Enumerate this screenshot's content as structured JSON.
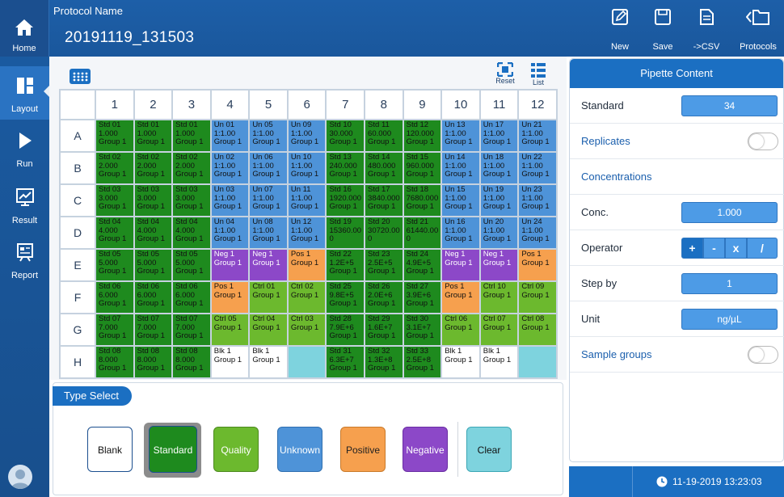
{
  "header": {
    "home_label": "Home",
    "protocol_caption": "Protocol Name",
    "protocol_value": "20191119_131503",
    "buttons": [
      {
        "label": "New",
        "icon": "edit-icon"
      },
      {
        "label": "Save",
        "icon": "save-icon"
      },
      {
        "label": "->CSV",
        "icon": "export-csv-icon"
      },
      {
        "label": "Protocols",
        "icon": "folder-icon"
      }
    ]
  },
  "sidebar": {
    "items": [
      {
        "label": "Layout",
        "icon": "layout-icon",
        "active": true
      },
      {
        "label": "Run",
        "icon": "play-icon",
        "active": false
      },
      {
        "label": "Result",
        "icon": "chart-icon",
        "active": false
      },
      {
        "label": "Report",
        "icon": "report-icon",
        "active": false
      }
    ]
  },
  "plate": {
    "tools": {
      "reset": "Reset",
      "list": "List"
    },
    "columns": [
      "1",
      "2",
      "3",
      "4",
      "5",
      "6",
      "7",
      "8",
      "9",
      "10",
      "11",
      "12"
    ],
    "rows": [
      {
        "label": "A",
        "cells": [
          {
            "type": "std",
            "l1": "Std 01",
            "l2": "1.000",
            "l3": "Group 1"
          },
          {
            "type": "std",
            "l1": "Std 01",
            "l2": "1.000",
            "l3": "Group 1"
          },
          {
            "type": "std",
            "l1": "Std 01",
            "l2": "1.000",
            "l3": "Group 1"
          },
          {
            "type": "unk",
            "l1": "Un 01",
            "l2": "1:1.00",
            "l3": "Group 1"
          },
          {
            "type": "unk",
            "l1": "Un 05",
            "l2": "1:1.00",
            "l3": "Group 1"
          },
          {
            "type": "unk",
            "l1": "Un 09",
            "l2": "1:1.00",
            "l3": "Group 1"
          },
          {
            "type": "std",
            "l1": "Std 10",
            "l2": "30.000",
            "l3": "Group 1"
          },
          {
            "type": "std",
            "l1": "Std 11",
            "l2": "60.000",
            "l3": "Group 1"
          },
          {
            "type": "std",
            "l1": "Std 12",
            "l2": "120.000",
            "l3": "Group 1"
          },
          {
            "type": "unk",
            "l1": "Un 13",
            "l2": "1:1.00",
            "l3": "Group 1"
          },
          {
            "type": "unk",
            "l1": "Un 17",
            "l2": "1:1.00",
            "l3": "Group 1"
          },
          {
            "type": "unk",
            "l1": "Un 21",
            "l2": "1:1.00",
            "l3": "Group 1"
          }
        ]
      },
      {
        "label": "B",
        "cells": [
          {
            "type": "std",
            "l1": "Std 02",
            "l2": "2.000",
            "l3": "Group 1"
          },
          {
            "type": "std",
            "l1": "Std 02",
            "l2": "2.000",
            "l3": "Group 1"
          },
          {
            "type": "std",
            "l1": "Std 02",
            "l2": "2.000",
            "l3": "Group 1"
          },
          {
            "type": "unk",
            "l1": "Un 02",
            "l2": "1:1.00",
            "l3": "Group 1"
          },
          {
            "type": "unk",
            "l1": "Un 06",
            "l2": "1:1.00",
            "l3": "Group 1"
          },
          {
            "type": "unk",
            "l1": "Un 10",
            "l2": "1:1.00",
            "l3": "Group 1"
          },
          {
            "type": "std",
            "l1": "Std 13",
            "l2": "240.000",
            "l3": "Group 1"
          },
          {
            "type": "std",
            "l1": "Std 14",
            "l2": "480.000",
            "l3": "Group 1"
          },
          {
            "type": "std",
            "l1": "Std 15",
            "l2": "960.000",
            "l3": "Group 1"
          },
          {
            "type": "unk",
            "l1": "Un 14",
            "l2": "1:1.00",
            "l3": "Group 1"
          },
          {
            "type": "unk",
            "l1": "Un 18",
            "l2": "1:1.00",
            "l3": "Group 1"
          },
          {
            "type": "unk",
            "l1": "Un 22",
            "l2": "1:1.00",
            "l3": "Group 1"
          }
        ]
      },
      {
        "label": "C",
        "cells": [
          {
            "type": "std",
            "l1": "Std 03",
            "l2": "3.000",
            "l3": "Group 1"
          },
          {
            "type": "std",
            "l1": "Std 03",
            "l2": "3.000",
            "l3": "Group 1"
          },
          {
            "type": "std",
            "l1": "Std 03",
            "l2": "3.000",
            "l3": "Group 1"
          },
          {
            "type": "unk",
            "l1": "Un 03",
            "l2": "1:1.00",
            "l3": "Group 1"
          },
          {
            "type": "unk",
            "l1": "Un 07",
            "l2": "1:1.00",
            "l3": "Group 1"
          },
          {
            "type": "unk",
            "l1": "Un 11",
            "l2": "1:1.00",
            "l3": "Group 1"
          },
          {
            "type": "std",
            "l1": "Std 16",
            "l2": "1920.000",
            "l3": "Group 1"
          },
          {
            "type": "std",
            "l1": "Std 17",
            "l2": "3840.000",
            "l3": "Group 1"
          },
          {
            "type": "std",
            "l1": "Std 18",
            "l2": "7680.000",
            "l3": "Group 1"
          },
          {
            "type": "unk",
            "l1": "Un 15",
            "l2": "1:1.00",
            "l3": "Group 1"
          },
          {
            "type": "unk",
            "l1": "Un 19",
            "l2": "1:1.00",
            "l3": "Group 1"
          },
          {
            "type": "unk",
            "l1": "Un 23",
            "l2": "1:1.00",
            "l3": "Group 1"
          }
        ]
      },
      {
        "label": "D",
        "cells": [
          {
            "type": "std",
            "l1": "Std 04",
            "l2": "4.000",
            "l3": "Group 1"
          },
          {
            "type": "std",
            "l1": "Std 04",
            "l2": "4.000",
            "l3": "Group 1"
          },
          {
            "type": "std",
            "l1": "Std 04",
            "l2": "4.000",
            "l3": "Group 1"
          },
          {
            "type": "unk",
            "l1": "Un 04",
            "l2": "1:1.00",
            "l3": "Group 1"
          },
          {
            "type": "unk",
            "l1": "Un 08",
            "l2": "1:1.00",
            "l3": "Group 1"
          },
          {
            "type": "unk",
            "l1": "Un 12",
            "l2": "1:1.00",
            "l3": "Group 1"
          },
          {
            "type": "std",
            "l1": "Std 19",
            "l2": "15360.00",
            "l3": "0"
          },
          {
            "type": "std",
            "l1": "Std 20",
            "l2": "30720.00",
            "l3": "0"
          },
          {
            "type": "std",
            "l1": "Std 21",
            "l2": "61440.00",
            "l3": "0"
          },
          {
            "type": "unk",
            "l1": "Un 16",
            "l2": "1:1.00",
            "l3": "Group 1"
          },
          {
            "type": "unk",
            "l1": "Un 20",
            "l2": "1:1.00",
            "l3": "Group 1"
          },
          {
            "type": "unk",
            "l1": "Un 24",
            "l2": "1:1.00",
            "l3": "Group 1"
          }
        ]
      },
      {
        "label": "E",
        "cells": [
          {
            "type": "std",
            "l1": "Std 05",
            "l2": "5.000",
            "l3": "Group 1"
          },
          {
            "type": "std",
            "l1": "Std 05",
            "l2": "5.000",
            "l3": "Group 1"
          },
          {
            "type": "std",
            "l1": "Std 05",
            "l2": "5.000",
            "l3": "Group 1"
          },
          {
            "type": "neg",
            "l1": "Neg 1",
            "l2": "Group 1",
            "l3": ""
          },
          {
            "type": "neg",
            "l1": "Neg 1",
            "l2": "Group 1",
            "l3": ""
          },
          {
            "type": "pos",
            "l1": "Pos 1",
            "l2": "Group 1",
            "l3": ""
          },
          {
            "type": "std",
            "l1": "Std 22",
            "l2": "1.2E+5",
            "l3": "Group 1"
          },
          {
            "type": "std",
            "l1": "Std 23",
            "l2": "2.5E+5",
            "l3": "Group 1"
          },
          {
            "type": "std",
            "l1": "Std 24",
            "l2": "4.9E+5",
            "l3": "Group 1"
          },
          {
            "type": "neg",
            "l1": "Neg 1",
            "l2": "Group 1",
            "l3": ""
          },
          {
            "type": "neg",
            "l1": "Neg 1",
            "l2": "Group 1",
            "l3": ""
          },
          {
            "type": "pos",
            "l1": "Pos 1",
            "l2": "Group 1",
            "l3": ""
          }
        ]
      },
      {
        "label": "F",
        "cells": [
          {
            "type": "std",
            "l1": "Std 06",
            "l2": "6.000",
            "l3": "Group 1"
          },
          {
            "type": "std",
            "l1": "Std 06",
            "l2": "6.000",
            "l3": "Group 1"
          },
          {
            "type": "std",
            "l1": "Std 06",
            "l2": "6.000",
            "l3": "Group 1"
          },
          {
            "type": "pos",
            "l1": "Pos 1",
            "l2": "Group 1",
            "l3": ""
          },
          {
            "type": "ctrl",
            "l1": "Ctrl 01",
            "l2": "Group 1",
            "l3": ""
          },
          {
            "type": "ctrl",
            "l1": "Ctrl 02",
            "l2": "Group 1",
            "l3": ""
          },
          {
            "type": "std",
            "l1": "Std 25",
            "l2": "9.8E+5",
            "l3": "Group 1"
          },
          {
            "type": "std",
            "l1": "Std 26",
            "l2": "2.0E+6",
            "l3": "Group 1"
          },
          {
            "type": "std",
            "l1": "Std 27",
            "l2": "3.9E+6",
            "l3": "Group 1"
          },
          {
            "type": "pos",
            "l1": "Pos 1",
            "l2": "Group 1",
            "l3": ""
          },
          {
            "type": "ctrl",
            "l1": "Ctrl 10",
            "l2": "Group 1",
            "l3": ""
          },
          {
            "type": "ctrl",
            "l1": "Ctrl 09",
            "l2": "Group 1",
            "l3": ""
          }
        ]
      },
      {
        "label": "G",
        "cells": [
          {
            "type": "std",
            "l1": "Std 07",
            "l2": "7.000",
            "l3": "Group 1"
          },
          {
            "type": "std",
            "l1": "Std 07",
            "l2": "7.000",
            "l3": "Group 1"
          },
          {
            "type": "std",
            "l1": "Std 07",
            "l2": "7.000",
            "l3": "Group 1"
          },
          {
            "type": "ctrl",
            "l1": "Ctrl 05",
            "l2": "Group 1",
            "l3": ""
          },
          {
            "type": "ctrl",
            "l1": "Ctrl 04",
            "l2": "Group 1",
            "l3": ""
          },
          {
            "type": "ctrl",
            "l1": "Ctrl 03",
            "l2": "Group 1",
            "l3": ""
          },
          {
            "type": "std",
            "l1": "Std 28",
            "l2": "7.9E+6",
            "l3": "Group 1"
          },
          {
            "type": "std",
            "l1": "Std 29",
            "l2": "1.6E+7",
            "l3": "Group 1"
          },
          {
            "type": "std",
            "l1": "Std 30",
            "l2": "3.1E+7",
            "l3": "Group 1"
          },
          {
            "type": "ctrl",
            "l1": "Ctrl 06",
            "l2": "Group 1",
            "l3": ""
          },
          {
            "type": "ctrl",
            "l1": "Ctrl 07",
            "l2": "Group 1",
            "l3": ""
          },
          {
            "type": "ctrl",
            "l1": "Ctrl 08",
            "l2": "Group 1",
            "l3": ""
          }
        ]
      },
      {
        "label": "H",
        "cells": [
          {
            "type": "std",
            "l1": "Std 08",
            "l2": "8.000",
            "l3": "Group 1"
          },
          {
            "type": "std",
            "l1": "Std 08",
            "l2": "8.000",
            "l3": "Group 1"
          },
          {
            "type": "std",
            "l1": "Std 08",
            "l2": "8.000",
            "l3": "Group 1"
          },
          {
            "type": "blk",
            "l1": "Blk 1",
            "l2": "Group 1",
            "l3": ""
          },
          {
            "type": "blk",
            "l1": "Blk 1",
            "l2": "Group 1",
            "l3": ""
          },
          {
            "type": "empty",
            "l1": "",
            "l2": "",
            "l3": ""
          },
          {
            "type": "std",
            "l1": "Std 31",
            "l2": "6.3E+7",
            "l3": "Group 1"
          },
          {
            "type": "std",
            "l1": "Std 32",
            "l2": "1.3E+8",
            "l3": "Group 1"
          },
          {
            "type": "std",
            "l1": "Std 33",
            "l2": "2.5E+8",
            "l3": "Group 1"
          },
          {
            "type": "blk",
            "l1": "Blk 1",
            "l2": "Group 1",
            "l3": ""
          },
          {
            "type": "blk",
            "l1": "Blk 1",
            "l2": "Group 1",
            "l3": ""
          },
          {
            "type": "empty",
            "l1": "",
            "l2": "",
            "l3": ""
          }
        ]
      }
    ]
  },
  "type_select": {
    "title": "Type Select",
    "buttons": [
      {
        "label": "Blank",
        "name": "type-blank-button",
        "bg": "#ffffff",
        "fg": "#111111",
        "border": "#1b4f8f",
        "selected": false
      },
      {
        "label": "Standard",
        "name": "type-standard-button",
        "bg": "#1e8a1e",
        "fg": "#ffffff",
        "border": "#1b4f8f",
        "selected": true
      },
      {
        "label": "Quality",
        "name": "type-quality-button",
        "bg": "#6cb92e",
        "fg": "#ffffff",
        "border": "#4d8a1f",
        "selected": false
      },
      {
        "label": "Unknown",
        "name": "type-unknown-button",
        "bg": "#4e93d8",
        "fg": "#ffffff",
        "border": "#2f6fb0",
        "selected": false
      },
      {
        "label": "Positive",
        "name": "type-positive-button",
        "bg": "#f6a04e",
        "fg": "#222222",
        "border": "#c97a2a",
        "selected": false
      },
      {
        "label": "Negative",
        "name": "type-negative-button",
        "bg": "#8c48c8",
        "fg": "#ffffff",
        "border": "#6a2ea3",
        "selected": false
      },
      {
        "label": "Clear",
        "name": "type-clear-button",
        "bg": "#7ed3de",
        "fg": "#111111",
        "border": "#3ca7b5",
        "selected": false
      }
    ]
  },
  "pipette": {
    "title": "Pipette Content",
    "standard_label": "Standard",
    "standard_value": "34",
    "replicates_label": "Replicates",
    "replicates_on": false,
    "concentrations_label": "Concentrations",
    "conc_label": "Conc.",
    "conc_value": "1.000",
    "operator_label": "Operator",
    "operators": [
      "+",
      "-",
      "x",
      "/"
    ],
    "step_label": "Step by",
    "step_value": "1",
    "unit_label": "Unit",
    "unit_value": "ng/µL",
    "sample_groups_label": "Sample groups",
    "sample_groups_on": false
  },
  "status": {
    "datetime": "11-19-2019 13:23:03"
  },
  "colors": {
    "primary": "#1b6fc2",
    "standard": "#1e8a1e",
    "unknown": "#4e93d8",
    "negative": "#8c48c8",
    "positive": "#f6a04e",
    "control": "#6cb92e",
    "empty": "#7ed3de"
  }
}
